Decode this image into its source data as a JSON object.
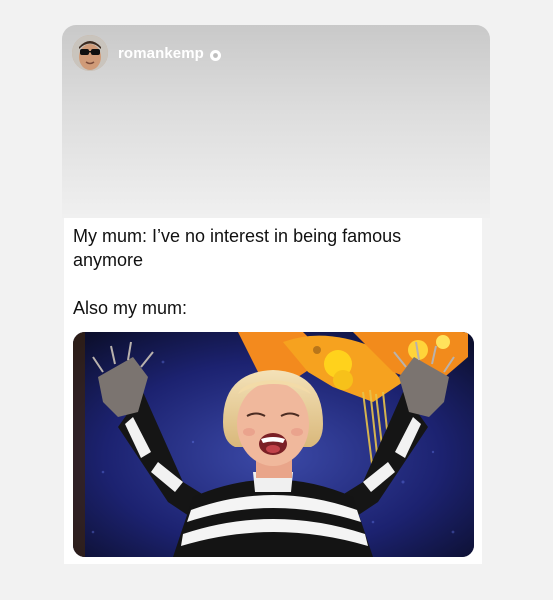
{
  "story": {
    "username": "romankemp",
    "verified": true,
    "avatar_icon": "user-avatar",
    "verified_icon": "verified-badge-icon"
  },
  "post": {
    "line1": "My mum: I’ve no interest in being famous",
    "line2": "anymore",
    "line3": "Also my mum:"
  },
  "media": {
    "kind": "photo",
    "subject": "cheering-woman"
  },
  "colors": {
    "page_bg": "#f2f2f2",
    "header_gradient_top": "#c9c9c9",
    "header_gradient_bottom": "#f0f0f0",
    "card_bg": "#ffffff",
    "text": "#111111",
    "username": "#ffffff"
  }
}
